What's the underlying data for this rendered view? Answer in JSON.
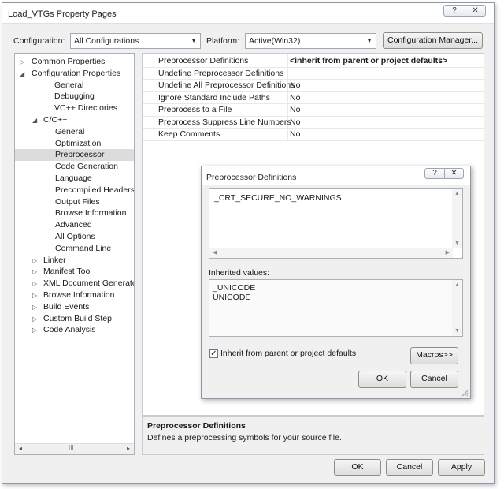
{
  "window": {
    "title": "Load_VTGs Property Pages"
  },
  "titlebar_buttons": {
    "help": "?",
    "close": "✕"
  },
  "config": {
    "configuration_label": "Configuration:",
    "configuration_value": "All Configurations",
    "platform_label": "Platform:",
    "platform_value": "Active(Win32)",
    "manager_button": "Configuration Manager..."
  },
  "tree": {
    "items": [
      {
        "label": "Common Properties",
        "twisty": "▷"
      },
      {
        "label": "Configuration Properties",
        "twisty": "◢"
      },
      {
        "label": "General"
      },
      {
        "label": "Debugging"
      },
      {
        "label": "VC++ Directories"
      },
      {
        "label": "C/C++",
        "twisty": "◢"
      },
      {
        "label": "General"
      },
      {
        "label": "Optimization"
      },
      {
        "label": "Preprocessor"
      },
      {
        "label": "Code Generation"
      },
      {
        "label": "Language"
      },
      {
        "label": "Precompiled Headers"
      },
      {
        "label": "Output Files"
      },
      {
        "label": "Browse Information"
      },
      {
        "label": "Advanced"
      },
      {
        "label": "All Options"
      },
      {
        "label": "Command Line"
      },
      {
        "label": "Linker",
        "twisty": "▷"
      },
      {
        "label": "Manifest Tool",
        "twisty": "▷"
      },
      {
        "label": "XML Document Generator",
        "twisty": "▷"
      },
      {
        "label": "Browse Information",
        "twisty": "▷"
      },
      {
        "label": "Build Events",
        "twisty": "▷"
      },
      {
        "label": "Custom Build Step",
        "twisty": "▷"
      },
      {
        "label": "Code Analysis",
        "twisty": "▷"
      }
    ],
    "scroll_left": "◂",
    "scroll_grip": "III",
    "scroll_right": "▸"
  },
  "properties": [
    {
      "name": "Preprocessor Definitions",
      "value": "<inherit from parent or project defaults>"
    },
    {
      "name": "Undefine Preprocessor Definitions",
      "value": ""
    },
    {
      "name": "Undefine All Preprocessor Definitions",
      "value": "No"
    },
    {
      "name": "Ignore Standard Include Paths",
      "value": "No"
    },
    {
      "name": "Preprocess to a File",
      "value": "No"
    },
    {
      "name": "Preprocess Suppress Line Numbers",
      "value": "No"
    },
    {
      "name": "Keep Comments",
      "value": "No"
    }
  ],
  "description": {
    "title": "Preprocessor Definitions",
    "text": "Defines a preprocessing symbols for your source file."
  },
  "dialog": {
    "title": "Preprocessor Definitions",
    "help": "?",
    "close": "✕",
    "definitions_text": "_CRT_SECURE_NO_WARNINGS",
    "inherited_label": "Inherited values:",
    "inherited_values": [
      "_UNICODE",
      "UNICODE"
    ],
    "inherit_checkbox_label": "Inherit from parent or project defaults",
    "inherit_checked": "✓",
    "macros_button": "Macros>>",
    "ok_button": "OK",
    "cancel_button": "Cancel"
  },
  "footer": {
    "ok": "OK",
    "cancel": "Cancel",
    "apply": "Apply"
  }
}
